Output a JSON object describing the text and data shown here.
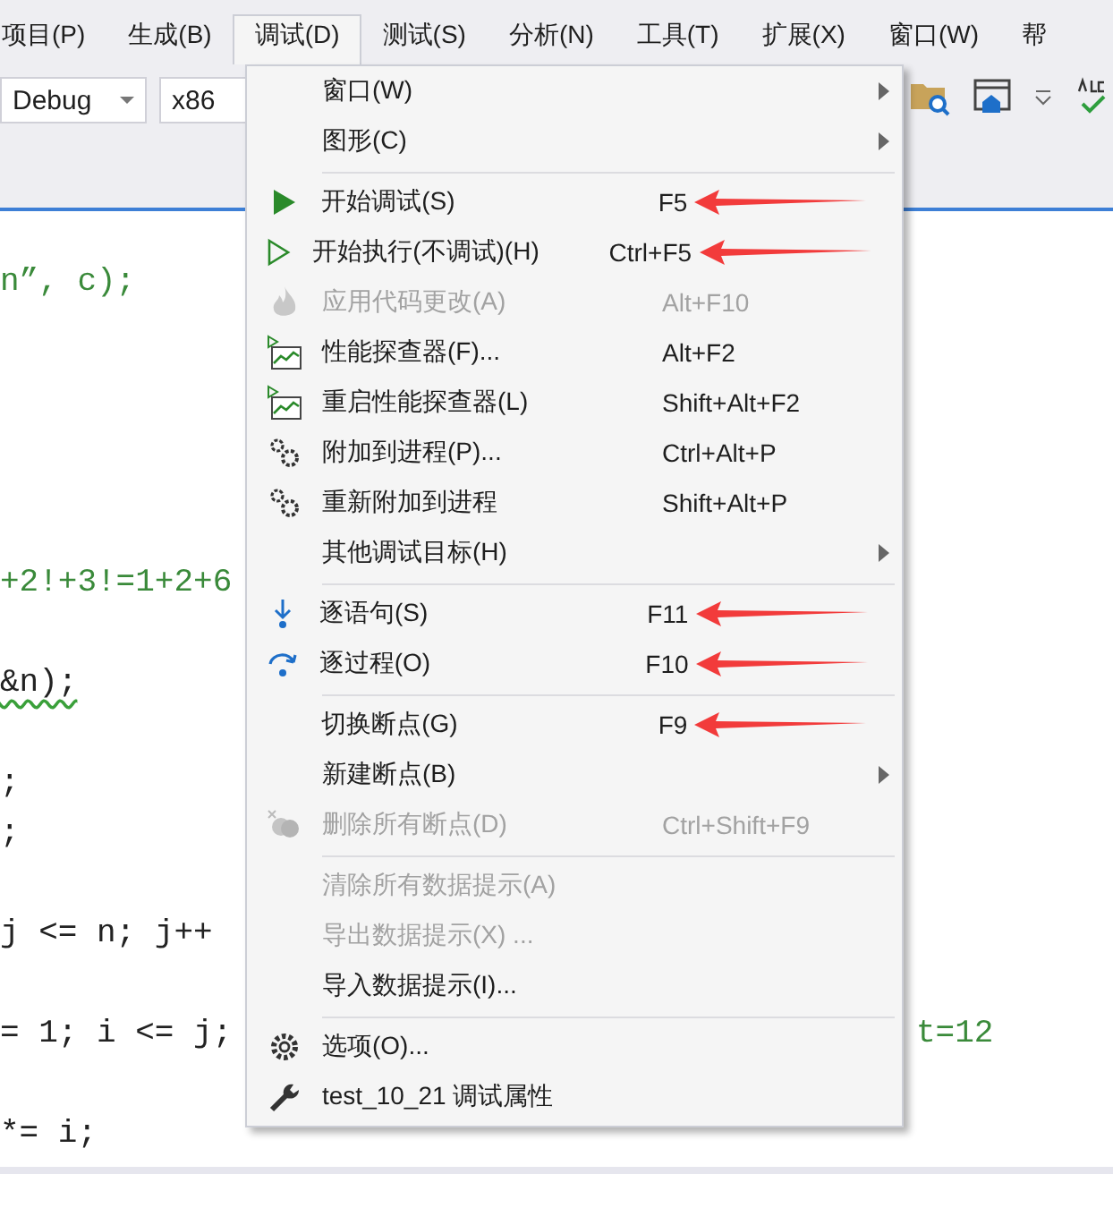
{
  "menu_bar": [
    {
      "label": "项目(P)",
      "selected": false
    },
    {
      "label": "生成(B)",
      "selected": false
    },
    {
      "label": "调试(D)",
      "selected": true
    },
    {
      "label": "测试(S)",
      "selected": false
    },
    {
      "label": "分析(N)",
      "selected": false
    },
    {
      "label": "工具(T)",
      "selected": false
    },
    {
      "label": "扩展(X)",
      "selected": false
    },
    {
      "label": "窗口(W)",
      "selected": false
    },
    {
      "label": "帮",
      "selected": false
    }
  ],
  "toolbar": {
    "configuration": "Debug",
    "platform": "x86"
  },
  "editor": {
    "lines": [
      {
        "kind": "comment",
        "text": "n”, c);"
      },
      {
        "kind": "blank"
      },
      {
        "kind": "blank"
      },
      {
        "kind": "blank"
      },
      {
        "kind": "blank"
      },
      {
        "kind": "blank"
      },
      {
        "kind": "comment",
        "text": "+2!+3!=1+2+6"
      },
      {
        "kind": "blank"
      },
      {
        "kind": "code",
        "text": "&n);",
        "squiggle": true
      },
      {
        "kind": "blank"
      },
      {
        "kind": "code",
        "text": ";"
      },
      {
        "kind": "code",
        "text": ";"
      },
      {
        "kind": "blank"
      },
      {
        "kind": "code",
        "text": "j <= n; j++"
      },
      {
        "kind": "blank"
      },
      {
        "kind": "code",
        "text": "= 1; i <= j;",
        "comment": "t=12"
      },
      {
        "kind": "blank"
      },
      {
        "kind": "code",
        "text": "*= i;"
      }
    ]
  },
  "debug_menu": [
    {
      "kind": "plain",
      "label": "窗口(W)",
      "submenu": true,
      "disabled": false,
      "marked": false
    },
    {
      "kind": "plain",
      "label": "图形(C)",
      "submenu": true,
      "disabled": false,
      "marked": false
    },
    {
      "kind": "separator"
    },
    {
      "kind": "play",
      "label": "开始调试(S)",
      "shortcut": "F5",
      "submenu": false,
      "disabled": false,
      "marked": true
    },
    {
      "kind": "play-outline",
      "label": "开始执行(不调试)(H)",
      "shortcut": "Ctrl+F5",
      "submenu": false,
      "disabled": false,
      "marked": true
    },
    {
      "kind": "flame",
      "label": "应用代码更改(A)",
      "shortcut": "Alt+F10",
      "submenu": false,
      "disabled": true,
      "marked": false
    },
    {
      "kind": "chart",
      "label": "性能探查器(F)...",
      "shortcut": "Alt+F2",
      "submenu": false,
      "disabled": false,
      "marked": false
    },
    {
      "kind": "chart",
      "label": "重启性能探查器(L)",
      "shortcut": "Shift+Alt+F2",
      "submenu": false,
      "disabled": false,
      "marked": false
    },
    {
      "kind": "gears",
      "label": "附加到进程(P)...",
      "shortcut": "Ctrl+Alt+P",
      "submenu": false,
      "disabled": false,
      "marked": false
    },
    {
      "kind": "gears",
      "label": "重新附加到进程",
      "shortcut": "Shift+Alt+P",
      "submenu": false,
      "disabled": false,
      "marked": false
    },
    {
      "kind": "plain",
      "label": "其他调试目标(H)",
      "submenu": true,
      "disabled": false,
      "marked": false
    },
    {
      "kind": "separator"
    },
    {
      "kind": "step-into",
      "label": "逐语句(S)",
      "shortcut": "F11",
      "submenu": false,
      "disabled": false,
      "marked": true
    },
    {
      "kind": "step-over",
      "label": "逐过程(O)",
      "shortcut": "F10",
      "submenu": false,
      "disabled": false,
      "marked": true
    },
    {
      "kind": "separator"
    },
    {
      "kind": "plain",
      "label": "切换断点(G)",
      "shortcut": "F9",
      "submenu": false,
      "disabled": false,
      "marked": true
    },
    {
      "kind": "plain",
      "label": "新建断点(B)",
      "submenu": true,
      "disabled": false,
      "marked": false
    },
    {
      "kind": "breakpoints",
      "label": "删除所有断点(D)",
      "shortcut": "Ctrl+Shift+F9",
      "submenu": false,
      "disabled": true,
      "marked": false
    },
    {
      "kind": "separator"
    },
    {
      "kind": "plain",
      "label": "清除所有数据提示(A)",
      "submenu": false,
      "disabled": true,
      "marked": false
    },
    {
      "kind": "plain",
      "label": "导出数据提示(X) ...",
      "submenu": false,
      "disabled": true,
      "marked": false
    },
    {
      "kind": "plain",
      "label": "导入数据提示(I)...",
      "submenu": false,
      "disabled": false,
      "marked": false
    },
    {
      "kind": "separator"
    },
    {
      "kind": "gear",
      "label": "选项(O)...",
      "submenu": false,
      "disabled": false,
      "marked": false
    },
    {
      "kind": "wrench",
      "label": "test_10_21 调试属性",
      "submenu": false,
      "disabled": false,
      "marked": false
    }
  ]
}
